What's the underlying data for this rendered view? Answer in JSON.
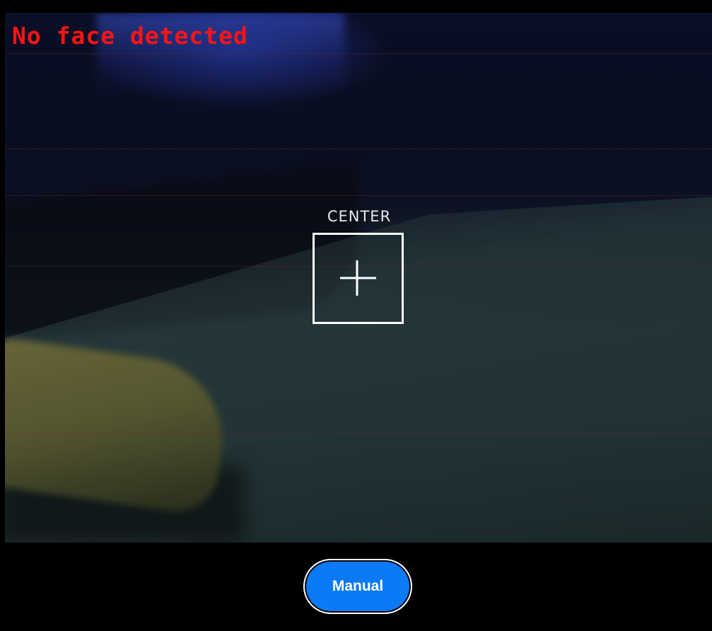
{
  "overlay": {
    "status_text": "No face detected",
    "status_color": "#ff1414",
    "target_label": "CENTER",
    "target_icon": "crosshair-icon"
  },
  "controls": {
    "mode_button_label": "Manual",
    "mode_button_color": "#0a7af5"
  }
}
